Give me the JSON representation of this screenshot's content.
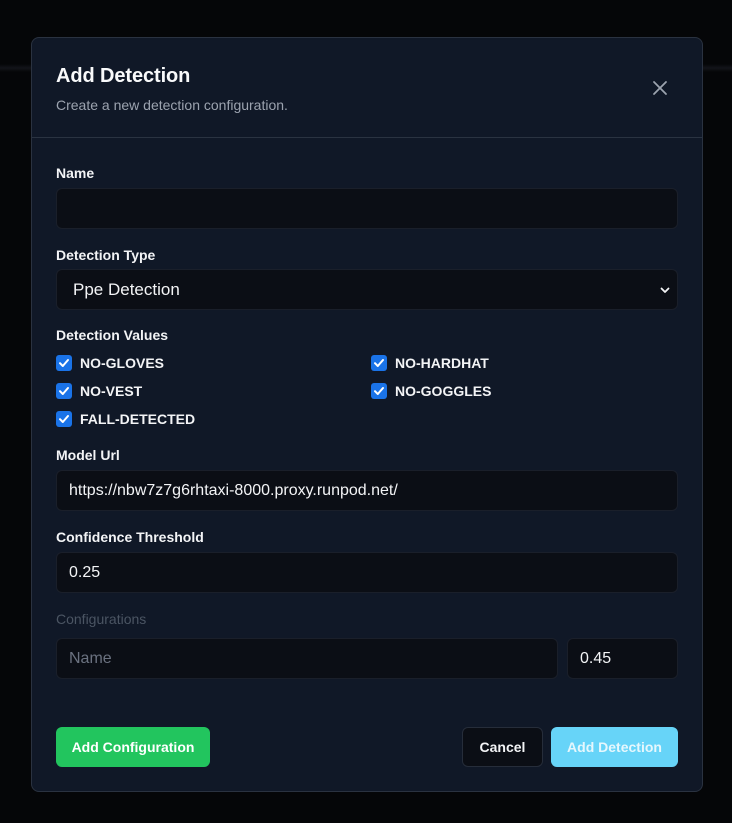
{
  "modal": {
    "title": "Add Detection",
    "subtitle": "Create a new detection configuration.",
    "close_icon": "close-icon"
  },
  "form": {
    "name": {
      "label": "Name",
      "value": "",
      "placeholder": ""
    },
    "detection_type": {
      "label": "Detection Type",
      "selected": "Ppe Detection"
    },
    "detection_values": {
      "label": "Detection Values",
      "items": [
        {
          "label": "NO-GLOVES",
          "checked": true
        },
        {
          "label": "NO-HARDHAT",
          "checked": true
        },
        {
          "label": "NO-VEST",
          "checked": true
        },
        {
          "label": "NO-GOGGLES",
          "checked": true
        },
        {
          "label": "FALL-DETECTED",
          "checked": true
        }
      ]
    },
    "model_url": {
      "label": "Model Url",
      "value": "https://nbw7z7g6rhtaxi-8000.proxy.runpod.net/"
    },
    "confidence_threshold": {
      "label": "Confidence Threshold",
      "value": "0.25"
    },
    "configurations": {
      "label": "Configurations",
      "name_placeholder": "Name",
      "threshold_value": "0.45"
    }
  },
  "buttons": {
    "add_configuration": "Add Configuration",
    "cancel": "Cancel",
    "add_detection": "Add Detection"
  },
  "colors": {
    "accent_blue": "#1a73e8",
    "green": "#22c55e",
    "primary_cyan": "#67d4f8",
    "modal_bg": "#101827"
  }
}
